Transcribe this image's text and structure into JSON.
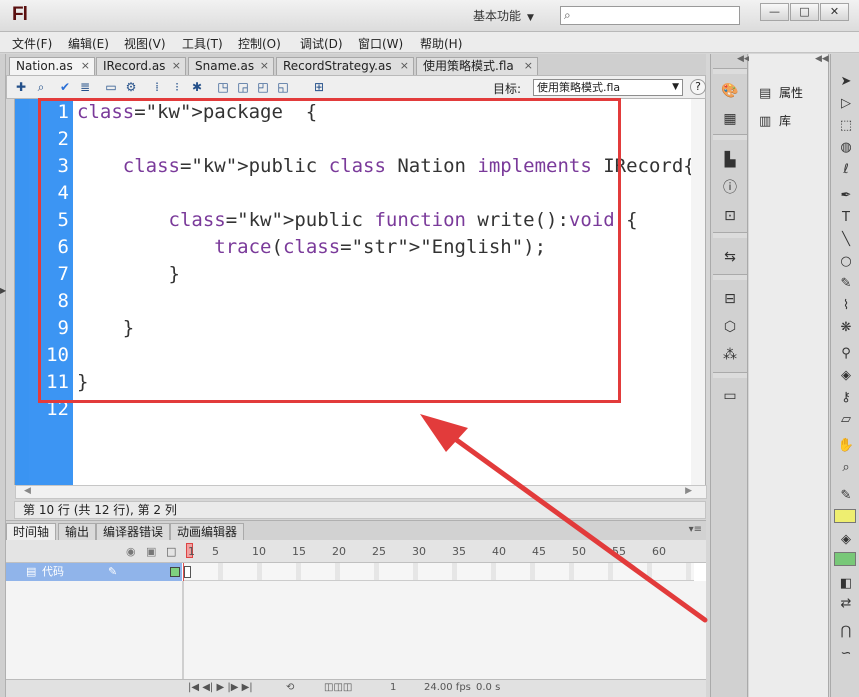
{
  "app": {
    "logo": "Fl",
    "workspace": "基本功能",
    "search_placeholder": ""
  },
  "window_controls": {
    "minimize": "—",
    "maximize": "□",
    "close": "✕"
  },
  "menu": [
    "文件(F)",
    "编辑(E)",
    "视图(V)",
    "工具(T)",
    "控制(O)",
    "调试(D)",
    "窗口(W)",
    "帮助(H)"
  ],
  "doc_tabs": [
    {
      "label": "Nation.as",
      "active": true
    },
    {
      "label": "IRecord.as",
      "active": false
    },
    {
      "label": "Sname.as",
      "active": false
    },
    {
      "label": "RecordStrategy.as",
      "active": false
    },
    {
      "label": "使用策略模式.fla",
      "active": false
    }
  ],
  "tab_close": "×",
  "toolbar": {
    "target_label": "目标:",
    "target_value": "使用策略模式.fla",
    "help": "?"
  },
  "code": {
    "line_numbers": [
      "1",
      "2",
      "3",
      "4",
      "5",
      "6",
      "7",
      "8",
      "9",
      "10",
      "11",
      "12"
    ],
    "lines": [
      "package  {",
      "",
      "    public class Nation implements IRecord{",
      "",
      "        public function write():void {",
      "            trace(\"English\");",
      "        }",
      "",
      "    }",
      "",
      "}",
      ""
    ]
  },
  "status": {
    "position": "第 10 行 (共 12 行), 第 2 列"
  },
  "timeline": {
    "tabs": [
      "时间轴",
      "输出",
      "编译器错误",
      "动画编辑器"
    ],
    "ruler": [
      "1",
      "5",
      "10",
      "15",
      "20",
      "25",
      "30",
      "35",
      "40",
      "45",
      "50",
      "55",
      "60"
    ],
    "layer_name": "代码",
    "current_frame": "1",
    "fps": "24.00 fps",
    "time": "0.0 s"
  },
  "panels": {
    "properties": "属性",
    "library": "库"
  },
  "colors": {
    "gutter": "#3c95f3",
    "highlight_border": "#e23b3b",
    "keyword": "#7a3a9a",
    "string": "#2a8c2a"
  }
}
